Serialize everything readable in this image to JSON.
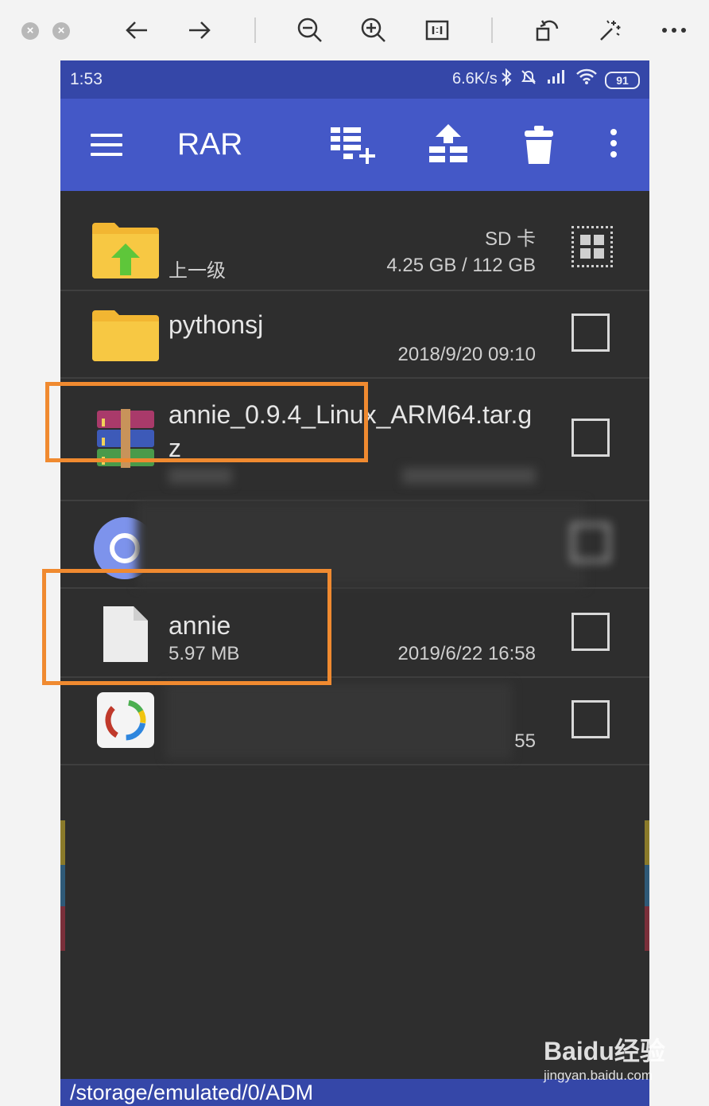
{
  "viewer_toolbar": {
    "icons": [
      "close-circle-icon",
      "minimize-circle-icon",
      "back-arrow-icon",
      "forward-arrow-icon",
      "zoom-out-icon",
      "zoom-in-icon",
      "actual-size-icon",
      "rotate-icon",
      "magic-wand-icon",
      "more-icon"
    ]
  },
  "status_bar": {
    "time": "1:53",
    "speed": "6.6K/s",
    "battery": "91"
  },
  "app_bar": {
    "title": "RAR"
  },
  "rows": [
    {
      "name": "",
      "sub": "上一级",
      "meta_top": "SD 卡",
      "meta": "4.25 GB / 112 GB",
      "icon": "folder-up-icon"
    },
    {
      "name": "pythonsj",
      "sub": "",
      "meta": "2018/9/20 09:10",
      "icon": "folder-icon"
    },
    {
      "name": "annie_0.9.4_Linux_ARM64.tar.gz",
      "sub": "",
      "meta": "",
      "icon": "rar-archive-icon"
    },
    {
      "name": "",
      "sub": "",
      "meta": "",
      "icon": "text-file-icon"
    },
    {
      "name": "annie",
      "sub": "5.97 MB",
      "meta": "2019/6/22 16:58",
      "icon": "file-icon"
    },
    {
      "name": "",
      "sub": "",
      "meta": "55",
      "icon": "apk-icon"
    }
  ],
  "footer": {
    "path": "/storage/emulated/0/ADM"
  },
  "watermark": {
    "brand": "Baidu经验",
    "url": "jingyan.baidu.com"
  },
  "colors": {
    "status_bar": "#3547a8",
    "app_bar": "#4458c7",
    "list_bg": "#2e2e2e",
    "highlight": "#f08a30"
  }
}
